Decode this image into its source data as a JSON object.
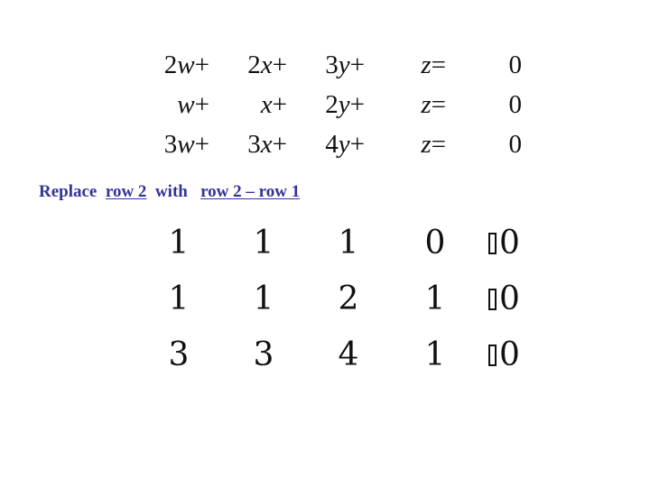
{
  "system": {
    "rows": [
      {
        "w": {
          "coef": "2",
          "var": "w",
          "op": "+"
        },
        "x": {
          "coef": "2",
          "var": "x",
          "op": "+"
        },
        "y": {
          "coef": "3",
          "var": "y",
          "op": "+"
        },
        "z": {
          "coef": "",
          "var": "z",
          "op": "="
        },
        "rhs": "0"
      },
      {
        "w": {
          "coef": "",
          "var": "w",
          "op": "+"
        },
        "x": {
          "coef": "",
          "var": "x",
          "op": "+"
        },
        "y": {
          "coef": "2",
          "var": "y",
          "op": "+"
        },
        "z": {
          "coef": "",
          "var": "z",
          "op": "="
        },
        "rhs": "0"
      },
      {
        "w": {
          "coef": "3",
          "var": "w",
          "op": "+"
        },
        "x": {
          "coef": "3",
          "var": "x",
          "op": "+"
        },
        "y": {
          "coef": "4",
          "var": "y",
          "op": "+"
        },
        "z": {
          "coef": "",
          "var": "z",
          "op": "="
        },
        "rhs": "0"
      }
    ]
  },
  "instruction": {
    "prefix": "Replace  ",
    "target_row": "row 2",
    "middle": "  with   ",
    "operation": "row 2 – row 1"
  },
  "matrix": {
    "rows": [
      {
        "cells": [
          "1",
          "1",
          "1",
          "0"
        ],
        "rhs": "0"
      },
      {
        "cells": [
          "1",
          "1",
          "2",
          "1"
        ],
        "rhs": "0"
      },
      {
        "cells": [
          "3",
          "3",
          "4",
          "1"
        ],
        "rhs": "0"
      }
    ],
    "separator_glyph": "missing-glyph-box"
  },
  "colors": {
    "instruction_text": "#333399",
    "body_text": "#111111",
    "background": "#ffffff"
  }
}
